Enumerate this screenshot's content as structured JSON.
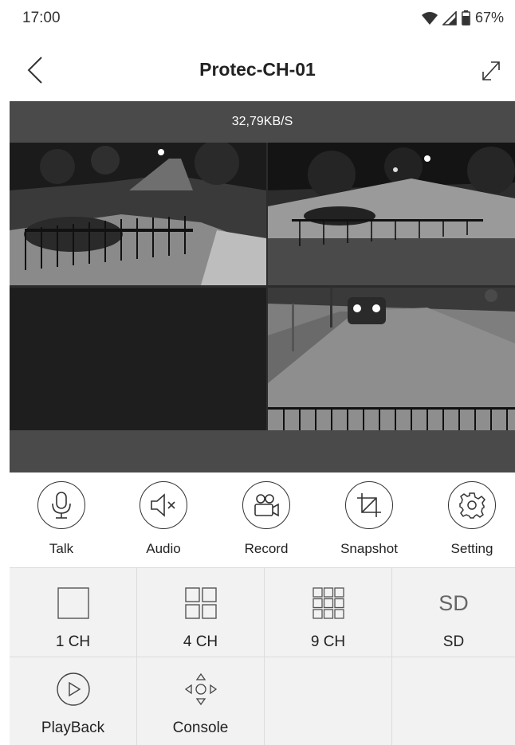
{
  "status_bar": {
    "time": "17:00",
    "battery": "67%"
  },
  "header": {
    "title": "Protec-CH-01"
  },
  "video": {
    "speed": "32,79KB/S"
  },
  "actions": [
    {
      "label": "Talk",
      "icon": "microphone-icon"
    },
    {
      "label": "Audio",
      "icon": "speaker-muted-icon"
    },
    {
      "label": "Record",
      "icon": "video-camera-icon"
    },
    {
      "label": "Snapshot",
      "icon": "crop-icon"
    },
    {
      "label": "Setting",
      "icon": "gear-icon"
    }
  ],
  "modes": [
    {
      "label": "1 CH",
      "icon": "single-view-icon"
    },
    {
      "label": "4 CH",
      "icon": "quad-view-icon"
    },
    {
      "label": "9 CH",
      "icon": "nine-view-icon"
    },
    {
      "label": "SD",
      "icon": "sd-icon",
      "icon_text": "SD"
    },
    {
      "label": "PlayBack",
      "icon": "play-icon"
    },
    {
      "label": "Console",
      "icon": "ptz-console-icon"
    }
  ],
  "colors": {
    "panel": "#4a4a4a",
    "grid_bg": "#f2f2f2",
    "divider": "#dcdcdc"
  }
}
